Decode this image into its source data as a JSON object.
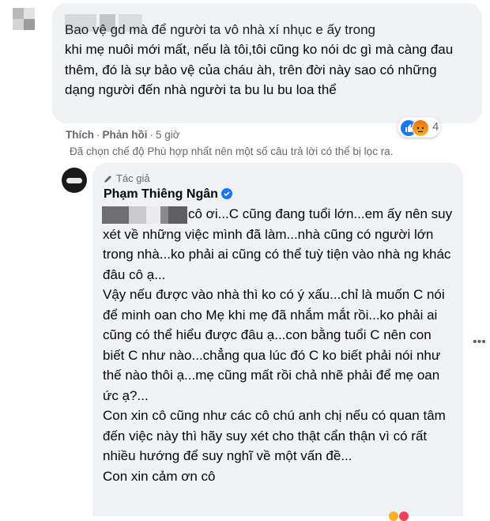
{
  "comment": {
    "first_line": "Bao vệ gd mà để người ta vô nhà xí nhục e ấy trong",
    "text": "khi mẹ nuôi mới mất, nếu là tôi,tôi cũng ko nói dc gì mà càng đau thêm, đó là sự bảo vệ của cháu àh, trên đời này sao có những dạng người đến nhà người ta bu lu bu loa thể",
    "like_label": "Thích",
    "reply_label": "Phản hồi",
    "time": "5 giờ",
    "reaction_count": "4",
    "filter_note": "Đã chọn chế độ Phù hợp nhất nên một số câu trả lời có thể bị lọc ra."
  },
  "reply": {
    "badge": "Tác giả",
    "author": "Phạm Thiêng Ngân",
    "para1": "cô ơi...C cũng đang tuổi lớn...em ấy nên suy xét về những việc mình đã làm...nhà cũng có người lớn trong nhà...ko phải ai cũng có thể tuỳ tiện vào nhà ng khác đâu cô ạ...",
    "para2": "Vậy nếu được vào nhà thì ko có ý xấu...chỉ là muốn C nói để minh oan cho Mẹ khi mẹ đã nhắm mắt rồi...ko phải ai cũng có thể hiểu được đâu ạ...con bằng tuổi C nên con biết C như nào...chẳng qua lúc đó C ko biết phải nói như thế nào thôi ạ...mẹ cũng mất rồi chả nhẽ phải để mẹ oan ức ạ?...",
    "para3": "Con xin cô cũng như các cô chú anh chị nếu có quan tâm đến việc này thì hãy suy xét cho thật cẩn thận vì có rất nhiều hướng để suy nghĩ về một vấn đề...",
    "para4": "Con xin cảm ơn cô",
    "more": "•••"
  },
  "colors": {
    "bubble": "#f0f2f5",
    "meta": "#65676b",
    "verified": "#1877f2"
  }
}
